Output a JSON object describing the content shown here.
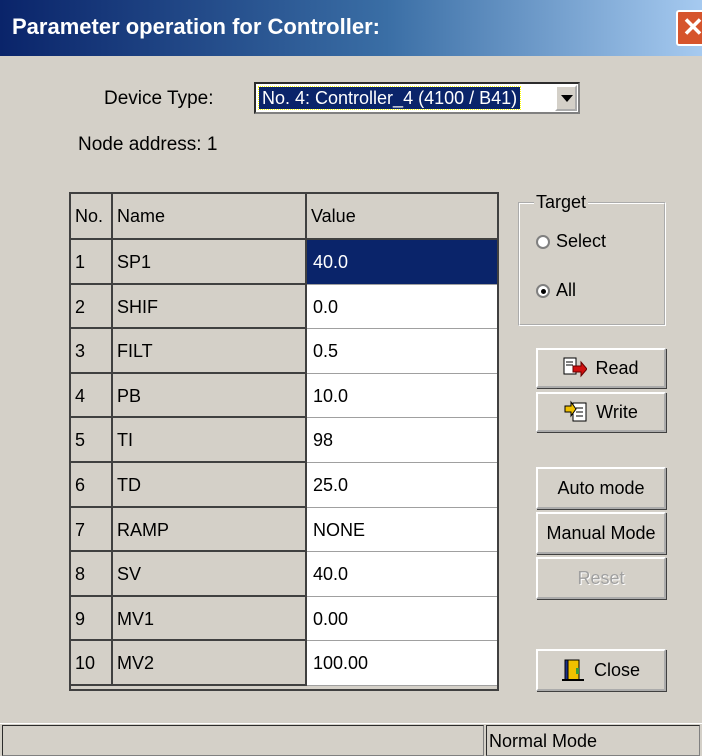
{
  "window": {
    "title": "Parameter operation for Controller:"
  },
  "device": {
    "label": "Device Type:",
    "value": "No. 4: Controller_4 (4100 / B41)"
  },
  "node": {
    "label": "Node address: 1"
  },
  "table": {
    "headers": [
      "No.",
      "Name",
      "Value"
    ],
    "rows": [
      {
        "no": "1",
        "name": "SP1",
        "value": "40.0"
      },
      {
        "no": "2",
        "name": "SHIF",
        "value": "0.0"
      },
      {
        "no": "3",
        "name": "FILT",
        "value": "0.5"
      },
      {
        "no": "4",
        "name": "PB",
        "value": "10.0"
      },
      {
        "no": "5",
        "name": "TI",
        "value": "98"
      },
      {
        "no": "6",
        "name": "TD",
        "value": "25.0"
      },
      {
        "no": "7",
        "name": "RAMP",
        "value": "NONE"
      },
      {
        "no": "8",
        "name": "SV",
        "value": "40.0"
      },
      {
        "no": "9",
        "name": "MV1",
        "value": "0.00"
      },
      {
        "no": "10",
        "name": "MV2",
        "value": "100.00"
      }
    ]
  },
  "target": {
    "label": "Target",
    "select": "Select",
    "all": "All",
    "selected": "All"
  },
  "buttons": {
    "read": "Read",
    "write": "Write",
    "auto": "Auto mode",
    "manual": "Manual Mode",
    "reset": "Reset",
    "close": "Close"
  },
  "status": {
    "mode": "Normal Mode"
  },
  "colors": {
    "selection": "#0a246a",
    "title_start": "#0a246a",
    "title_end": "#a6caf0"
  }
}
